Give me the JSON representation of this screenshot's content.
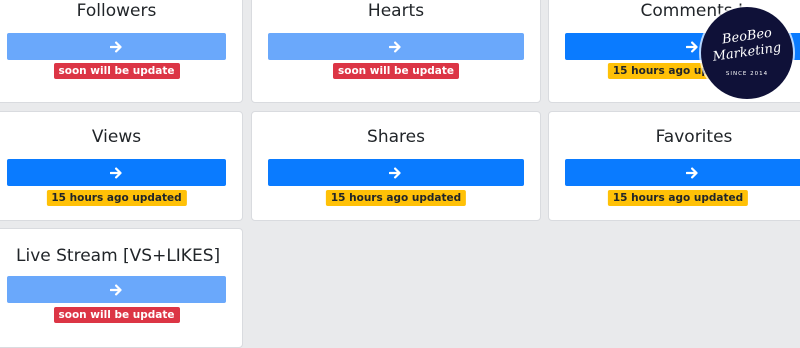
{
  "cards": {
    "followers": {
      "title": "Followers",
      "status": "soon will be update"
    },
    "hearts": {
      "title": "Hearts",
      "status": "soon will be update"
    },
    "comments": {
      "title": "Comments L",
      "status": "15 hours ago updated"
    },
    "views": {
      "title": "Views",
      "status": "15 hours ago updated"
    },
    "shares": {
      "title": "Shares",
      "status": "15 hours ago updated"
    },
    "favorites": {
      "title": "Favorites",
      "status": "15 hours ago updated"
    },
    "live_stream": {
      "title": "Live Stream [VS+LIKES]",
      "status": "soon will be update"
    }
  },
  "button_icon": "arrow-right-icon",
  "logo": {
    "line1": "BeoBeo",
    "line2": "Marketing",
    "line3": "SINCE 2014"
  },
  "colors": {
    "page_background": "#e9eaec",
    "primary_button": "#0a7bff",
    "disabled_button": "#6aa8fb",
    "badge_danger": "#dc3545",
    "badge_warning": "#ffc107",
    "logo_background": "#0f1138"
  }
}
